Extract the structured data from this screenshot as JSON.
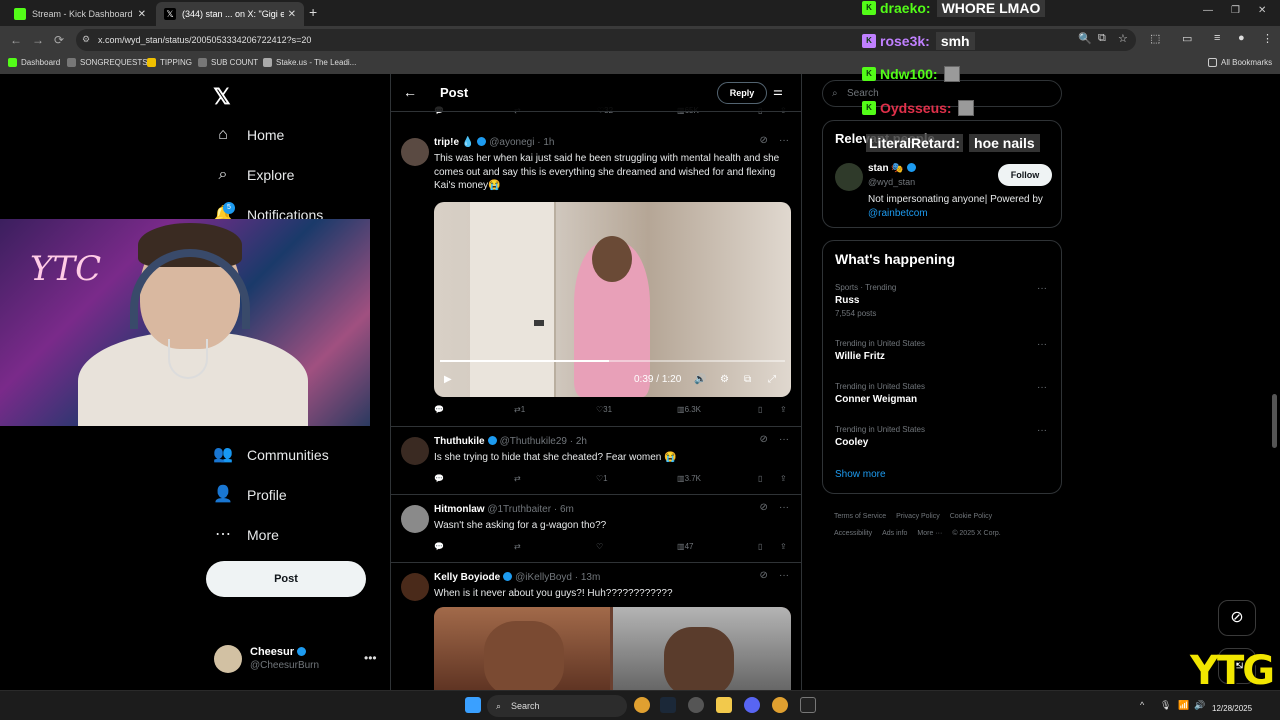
{
  "browser": {
    "tabs": [
      {
        "title": "Stream - Kick Dashboard",
        "favicon_color": "#53fc18"
      },
      {
        "title": "(344) stan ... on X: \"Gigi e...",
        "favicon_color": "#000000"
      }
    ],
    "url": "x.com/wyd_stan/status/2005053334206722412?s=20",
    "bookmarks": [
      "Dashboard",
      "SONGREQUESTS",
      "TIPPING",
      "SUB COUNT",
      "Stake.us - The Leadi..."
    ],
    "all_bookmarks": "All Bookmarks"
  },
  "nav": {
    "items": [
      "Home",
      "Explore",
      "Notifications",
      "Communities",
      "Profile",
      "More"
    ],
    "notif_badge": "5",
    "post_label": "Post",
    "me": {
      "name": "Cheesur",
      "handle": "@CheesurBurn"
    }
  },
  "header": {
    "title": "Post",
    "reply_label": "Reply"
  },
  "top_stats": {
    "likes": "32",
    "views": "65K"
  },
  "tweets": [
    {
      "name": "trip!e",
      "handle": "@ayonegi",
      "time": "1h",
      "text": "This was her when kai  just said he been struggling with mental health and she comes out and say this is everything she dreamed and wished for and flexing Kai's money😭",
      "video": {
        "current": "0:39",
        "total": "1:20",
        "progress": 0.49
      },
      "replies": "",
      "reposts": "1",
      "likes": "31",
      "views": "6.3K"
    },
    {
      "name": "Thuthukile",
      "handle": "@Thuthukile29",
      "time": "2h",
      "text": "Is she trying to hide that she cheated? Fear women 😭",
      "replies": "",
      "reposts": "",
      "likes": "1",
      "views": "3.7K"
    },
    {
      "name": "Hitmonlaw",
      "handle": "@1Truthbaiter",
      "time": "6m",
      "text": "Wasn't she asking for a g-wagon tho??",
      "replies": "",
      "reposts": "",
      "likes": "",
      "views": "47"
    },
    {
      "name": "Kelly Boyiode",
      "handle": "@iKellyBoyd",
      "time": "13m",
      "text": "When is it never about you guys?! Huh????????????"
    }
  ],
  "right": {
    "search_placeholder": "Search",
    "relevant_title": "Relevant people",
    "person": {
      "name": "stan 🎭",
      "handle": "@wyd_stan",
      "bio": "Not impersonating anyone| Powered by ",
      "bio_link": "@rainbetcom",
      "follow_label": "Follow"
    },
    "happening_title": "What's happening",
    "trends": [
      {
        "context": "Sports · Trending",
        "name": "Russ",
        "count": "7,554 posts"
      },
      {
        "context": "Trending in United States",
        "name": "Willie Fritz",
        "count": ""
      },
      {
        "context": "Trending in United States",
        "name": "Conner Weigman",
        "count": ""
      },
      {
        "context": "Trending in United States",
        "name": "Cooley",
        "count": ""
      }
    ],
    "show_more": "Show more",
    "footer": [
      "Terms of Service",
      "Privacy Policy",
      "Cookie Policy",
      "Accessibility",
      "Ads info",
      "More ···",
      "© 2025 X Corp."
    ]
  },
  "chat": [
    {
      "user": "draeko:",
      "msg": "WHORE LMAO",
      "color": "#53fc18"
    },
    {
      "user": "rose3k:",
      "msg": "smh",
      "color": "#c080ff"
    },
    {
      "user": "Ndw100:",
      "msg": "",
      "color": "#53fc18"
    },
    {
      "user": "Oydsseus:",
      "msg": "",
      "color": "#e0304a"
    },
    {
      "user": "LiteralRetard:",
      "msg": "hoe nails",
      "color": "#ffffff"
    }
  ],
  "overlay": {
    "webcam_text": "YTC",
    "brand": "YTG"
  },
  "taskbar": {
    "search_label": "Search",
    "date": "12/28/2025"
  },
  "colors": {
    "accent": "#1d9bf0",
    "kick_green": "#53fc18",
    "brand_yellow": "#f2e600"
  }
}
